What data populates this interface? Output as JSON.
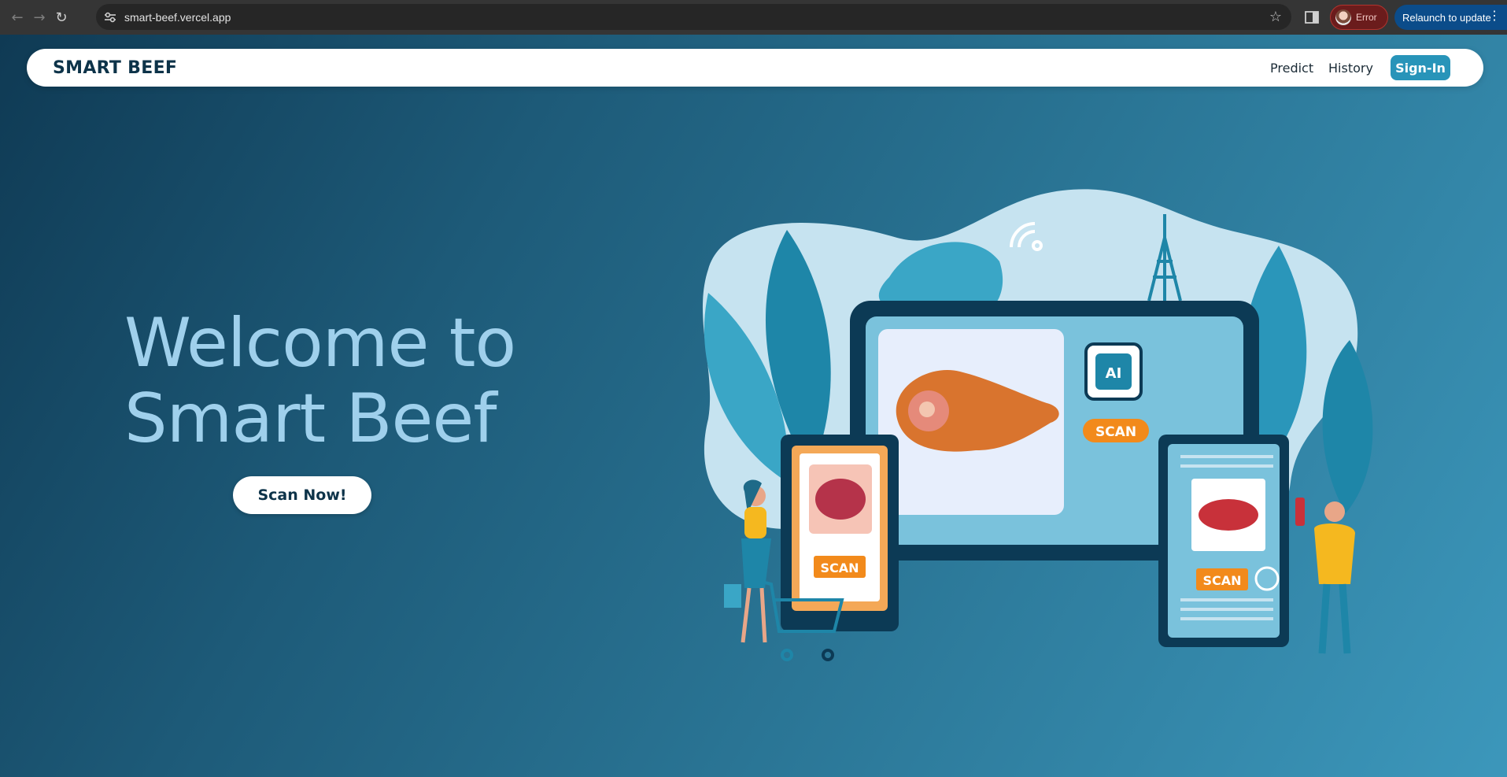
{
  "browser": {
    "url": "smart-beef.vercel.app",
    "profile_status": "Error",
    "relaunch_label": "Relaunch to update"
  },
  "navbar": {
    "brand": "SMART BEEF",
    "links": [
      "Predict",
      "History"
    ],
    "signin_label": "Sign-In"
  },
  "hero": {
    "title_line1": "Welcome to",
    "title_line2": "Smart Beef",
    "cta_label": "Scan Now!"
  },
  "illustration": {
    "scan_label": "SCAN",
    "ai_label": "AI"
  },
  "colors": {
    "accent": "#2894b9",
    "brand_dark": "#0d3349",
    "hero_text": "#9fd0ec",
    "scan_orange": "#f28a1b"
  }
}
